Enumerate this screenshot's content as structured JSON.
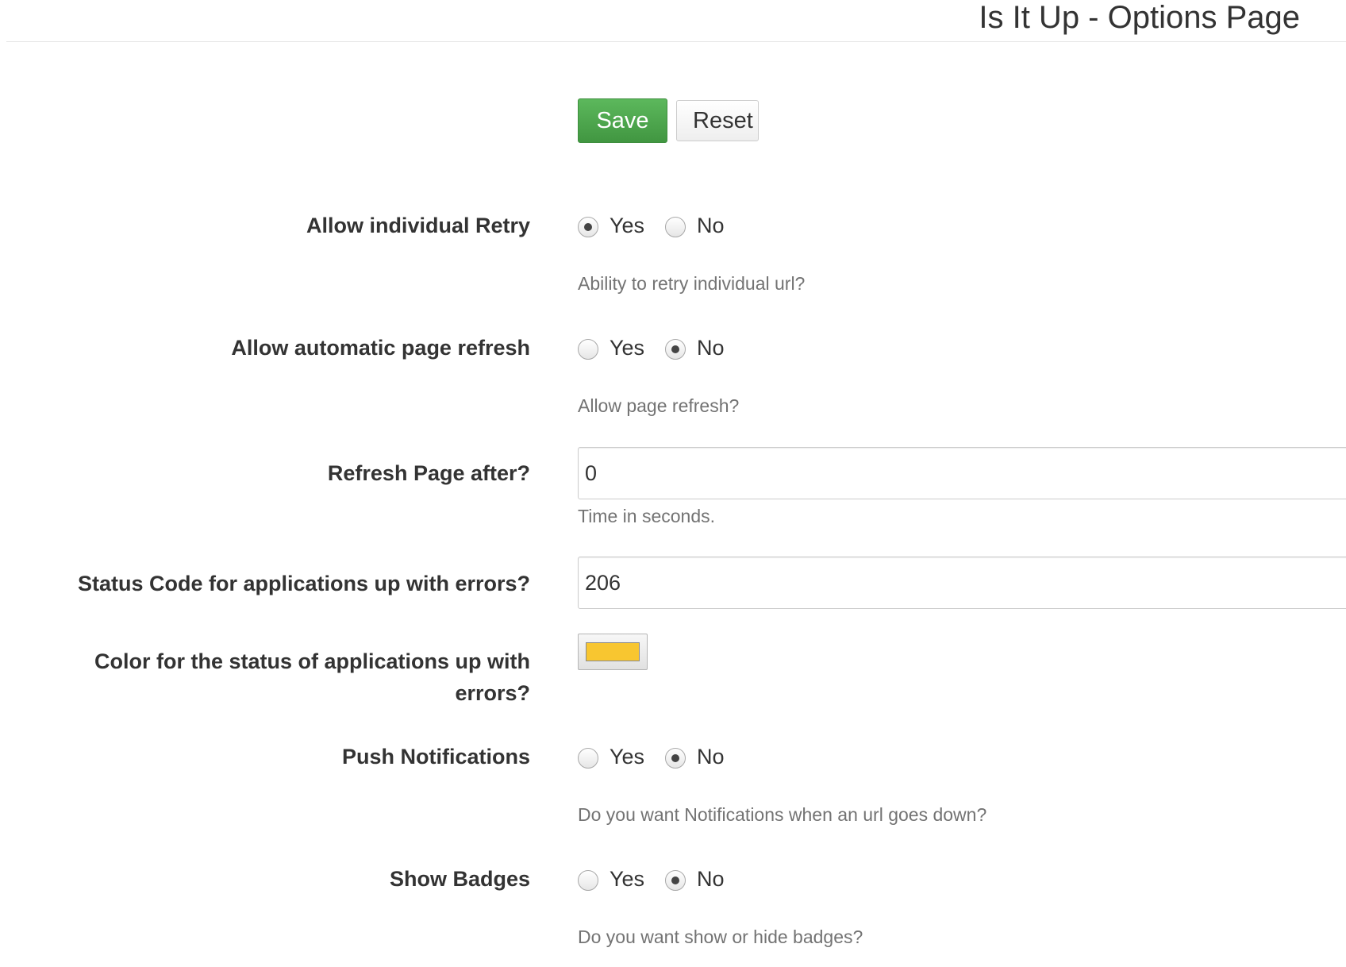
{
  "header": {
    "title": "Is It Up - Options Page"
  },
  "actions": {
    "save_label": "Save",
    "reset_label": "Reset"
  },
  "options": {
    "retry": {
      "label": "Allow individual Retry",
      "yes_label": "Yes",
      "no_label": "No",
      "selected": "Yes",
      "help": "Ability to retry individual url?"
    },
    "refresh": {
      "label": "Allow automatic page refresh",
      "yes_label": "Yes",
      "no_label": "No",
      "selected": "No",
      "help": "Allow page refresh?"
    },
    "refresh_after": {
      "label": "Refresh Page after?",
      "value": "0",
      "help": "Time in seconds."
    },
    "status_code": {
      "label": "Status Code for applications up with errors?",
      "value": "206"
    },
    "status_color": {
      "label": "Color for the status of applications up with errors?",
      "value": "#f8c630"
    },
    "push": {
      "label": "Push Notifications",
      "yes_label": "Yes",
      "no_label": "No",
      "selected": "No",
      "help": "Do you want Notifications when an url goes down?"
    },
    "badges": {
      "label": "Show Badges",
      "yes_label": "Yes",
      "no_label": "No",
      "selected": "No",
      "help": "Do you want show or hide badges?"
    }
  },
  "colors": {
    "save_button": "#4cae4c",
    "help_text": "#737373"
  },
  "icons": {
    "radio_checked": "radio-checked-icon",
    "radio_unchecked": "radio-unchecked-icon"
  }
}
